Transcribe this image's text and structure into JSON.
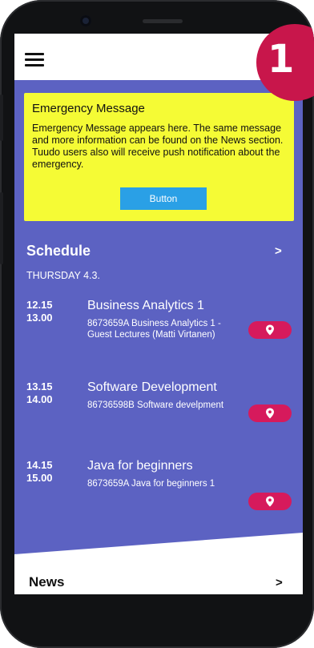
{
  "badge": {
    "number": "1"
  },
  "emergency": {
    "title": "Emergency Message",
    "body": "Emergency Message appears here. The same message and more information can be found on the News section. Tuudo users also will receive push notification about the emergency.",
    "button_label": "Button"
  },
  "schedule": {
    "title": "Schedule",
    "arrow": ">",
    "day": "THURSDAY 4.3.",
    "events": [
      {
        "start": "12.15",
        "end": "13.00",
        "title": "Business Analytics 1",
        "desc": "8673659A Business Analytics 1 - Guest Lectures (Matti Virtanen)"
      },
      {
        "start": "13.15",
        "end": "14.00",
        "title": "Software Development",
        "desc": "86736598B Software develpment"
      },
      {
        "start": "14.15",
        "end": "15.00",
        "title": "Java for beginners",
        "desc": "8673659A Java for beginners 1"
      }
    ]
  },
  "news": {
    "title": "News",
    "arrow": ">"
  },
  "icons": {
    "menu": "hamburger-menu-icon",
    "location": "map-pin-icon"
  },
  "colors": {
    "panel": "#5c62c2",
    "emergency": "#f5fb35",
    "button": "#2aa0e6",
    "pin": "#d61a5c",
    "badge": "#c8164b"
  }
}
